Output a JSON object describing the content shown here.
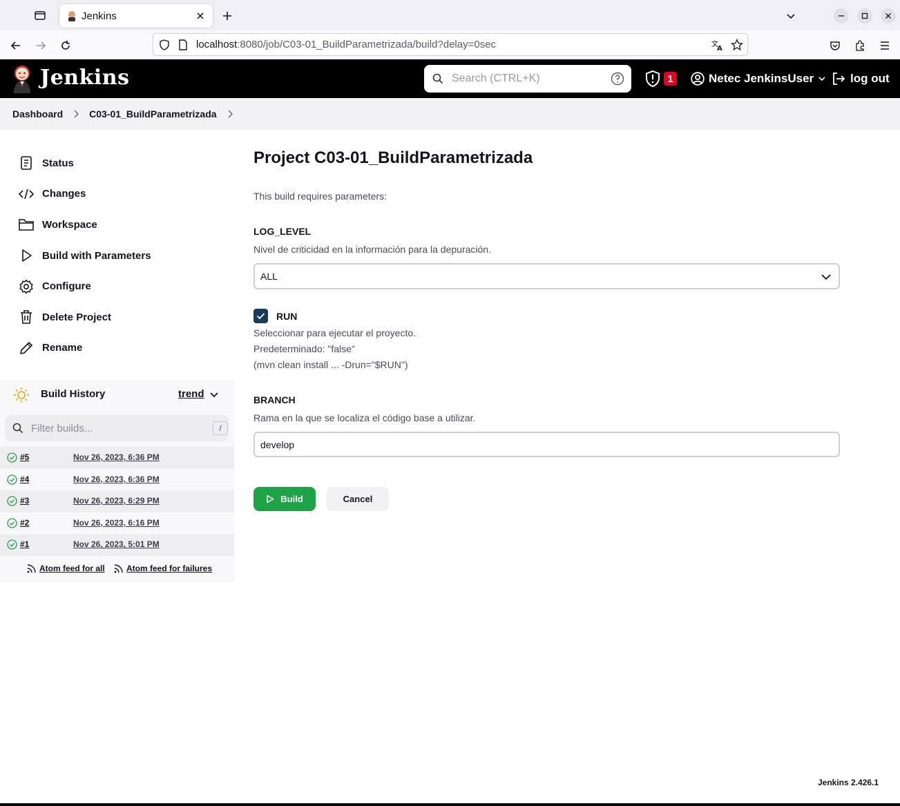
{
  "browser": {
    "tab_title": "Jenkins",
    "url_host": "localhost",
    "url_rest": ":8080/job/C03-01_BuildParametrizada/build?delay=0sec"
  },
  "header": {
    "brand": "Jenkins",
    "search_placeholder": "Search (CTRL+K)",
    "security_count": "1",
    "user_name": "Netec JenkinsUser",
    "logout_label": "log out"
  },
  "breadcrumb": {
    "items": [
      "Dashboard",
      "C03-01_BuildParametrizada"
    ]
  },
  "sidebar": {
    "items": [
      {
        "label": "Status",
        "icon": "notepad-icon"
      },
      {
        "label": "Changes",
        "icon": "code-icon"
      },
      {
        "label": "Workspace",
        "icon": "folder-icon"
      },
      {
        "label": "Build with Parameters",
        "icon": "play-icon"
      },
      {
        "label": "Configure",
        "icon": "gear-icon"
      },
      {
        "label": "Delete Project",
        "icon": "trash-icon"
      },
      {
        "label": "Rename",
        "icon": "pencil-icon"
      }
    ]
  },
  "build_history": {
    "title": "Build History",
    "trend_label": "trend",
    "filter_placeholder": "Filter builds...",
    "filter_shortcut": "/",
    "builds": [
      {
        "number": "#5",
        "date": "Nov 26, 2023, 6:36 PM"
      },
      {
        "number": "#4",
        "date": "Nov 26, 2023, 6:36 PM"
      },
      {
        "number": "#3",
        "date": "Nov 26, 2023, 6:29 PM"
      },
      {
        "number": "#2",
        "date": "Nov 26, 2023, 6:16 PM"
      },
      {
        "number": "#1",
        "date": "Nov 26, 2023, 5:01 PM"
      }
    ],
    "feed_all": "Atom feed for all",
    "feed_failures": "Atom feed for failures"
  },
  "main": {
    "title": "Project C03-01_BuildParametrizada",
    "intro": "This build requires parameters:",
    "params": {
      "log_level": {
        "name": "LOG_LEVEL",
        "description": "Nivel de criticidad en la información para la depuración.",
        "value": "ALL"
      },
      "run": {
        "name": "RUN",
        "checked": true,
        "description_lines": [
          "Seleccionar para ejecutar el proyecto.",
          "Predeterminado: \"false\"",
          "(mvn clean install ... -Drun=\"$RUN\")"
        ]
      },
      "branch": {
        "name": "BRANCH",
        "description": "Rama en la que se localiza el código base a utilizar.",
        "value": "develop"
      }
    },
    "build_label": "Build",
    "cancel_label": "Cancel"
  },
  "footer": {
    "version": "Jenkins 2.426.1"
  },
  "colors": {
    "header_bg": "#000000",
    "build_button": "#1ea446",
    "checkbox": "#1a3a5c",
    "alert_badge": "#e6001f"
  }
}
